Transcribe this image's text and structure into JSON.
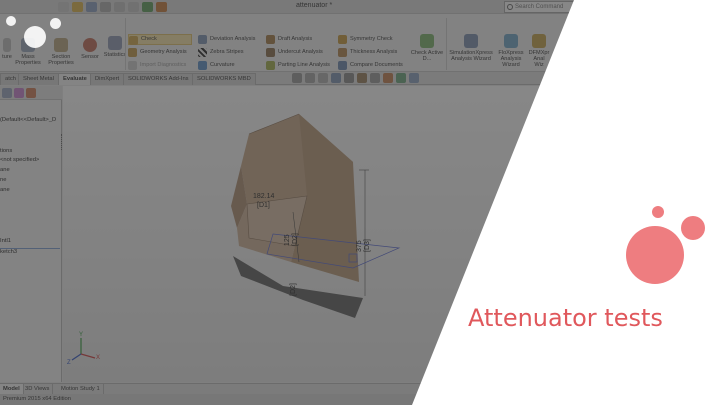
{
  "window": {
    "doc_title": "attenuator *",
    "search_placeholder": "Search Command"
  },
  "ribbon": {
    "big_buttons": [
      {
        "label": "Mass Properties"
      },
      {
        "label": "Section Properties"
      },
      {
        "label": "Sensor"
      },
      {
        "label": "Statistics"
      },
      {
        "label": "Check Active D..."
      },
      {
        "label": "SimulationXpress Analysis Wizard"
      },
      {
        "label": "FloXpress Analysis Wizard"
      },
      {
        "label": "DFMXpr Anal Wiz"
      }
    ],
    "left_fragment": "ture",
    "col1": [
      "Check",
      "Geometry Analysis",
      "Import Diagnostics"
    ],
    "col2": [
      "Deviation Analysis",
      "Zebra Stripes",
      "Curvature"
    ],
    "col3": [
      "Draft Analysis",
      "Undercut Analysis",
      "Parting Line Analysis"
    ],
    "col4": [
      "Symmetry Check",
      "Thickness Analysis",
      "Compare Documents"
    ]
  },
  "tabs": [
    {
      "label": "atch"
    },
    {
      "label": "Sheet Metal"
    },
    {
      "label": "Evaluate",
      "active": true
    },
    {
      "label": "DimXpert"
    },
    {
      "label": "SOLIDWORKS Add-Ins"
    },
    {
      "label": "SOLIDWORKS MBD"
    }
  ],
  "tree": {
    "items": [
      "(Default<<Default>_D",
      "tions",
      "<not specified>",
      "ane",
      "ne",
      "ane",
      "Intl1",
      "ketch3"
    ]
  },
  "model": {
    "dims": [
      {
        "text": "182.14"
      },
      {
        "text": "[D1]"
      },
      {
        "text": "125"
      },
      {
        "text": "[D2]"
      },
      {
        "text": "375"
      },
      {
        "text": "[D3]"
      },
      {
        "text": "[D2]"
      }
    ],
    "triad": {
      "x": "X",
      "y": "Y",
      "z": "Z"
    }
  },
  "bottom_tabs": [
    {
      "label": "Model",
      "active": true
    },
    {
      "label": "3D Views"
    },
    {
      "label": "Motion Study 1"
    }
  ],
  "status": "Premium 2015 x64 Edition",
  "slide": {
    "title": "Attenuator tests",
    "accent": "#ee7d80",
    "title_color": "#e0585c"
  }
}
